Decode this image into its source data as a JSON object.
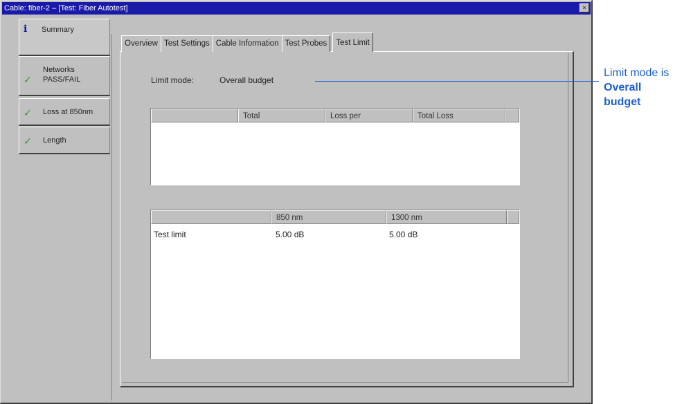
{
  "window": {
    "title": "Cable: fiber-2 – [Test: Fiber Autotest]",
    "close_glyph": "×"
  },
  "side_tabs": [
    {
      "label": "Summary",
      "icon": "info-icon",
      "glyph": "i"
    },
    {
      "label": "Networks PASS/FAIL",
      "line1": "Networks",
      "line2": "PASS/FAIL",
      "icon": "check-icon",
      "glyph": "✓"
    },
    {
      "label": "Loss at 850nm",
      "icon": "check-icon",
      "glyph": "✓"
    },
    {
      "label": "Length",
      "icon": "check-icon",
      "glyph": "✓"
    }
  ],
  "top_tabs": [
    "Overview",
    "Test Settings",
    "Cable Information",
    "Test Probes",
    "Test Limit"
  ],
  "active_top_tab": "Test Limit",
  "limit": {
    "label": "Limit mode:",
    "value": "Overall budget"
  },
  "table1": {
    "headers": [
      "",
      "Total",
      "Loss per",
      "Total Loss",
      ""
    ]
  },
  "table2": {
    "headers": [
      "",
      "850 nm",
      "1300 nm",
      ""
    ],
    "rows": [
      {
        "label": "Test limit",
        "v850": "5.00 dB",
        "v1300": "5.00 dB"
      }
    ]
  },
  "callout": {
    "line1": "Limit mode is",
    "line2": "Overall",
    "line3": "budget",
    "color": "#1a5fd0"
  }
}
